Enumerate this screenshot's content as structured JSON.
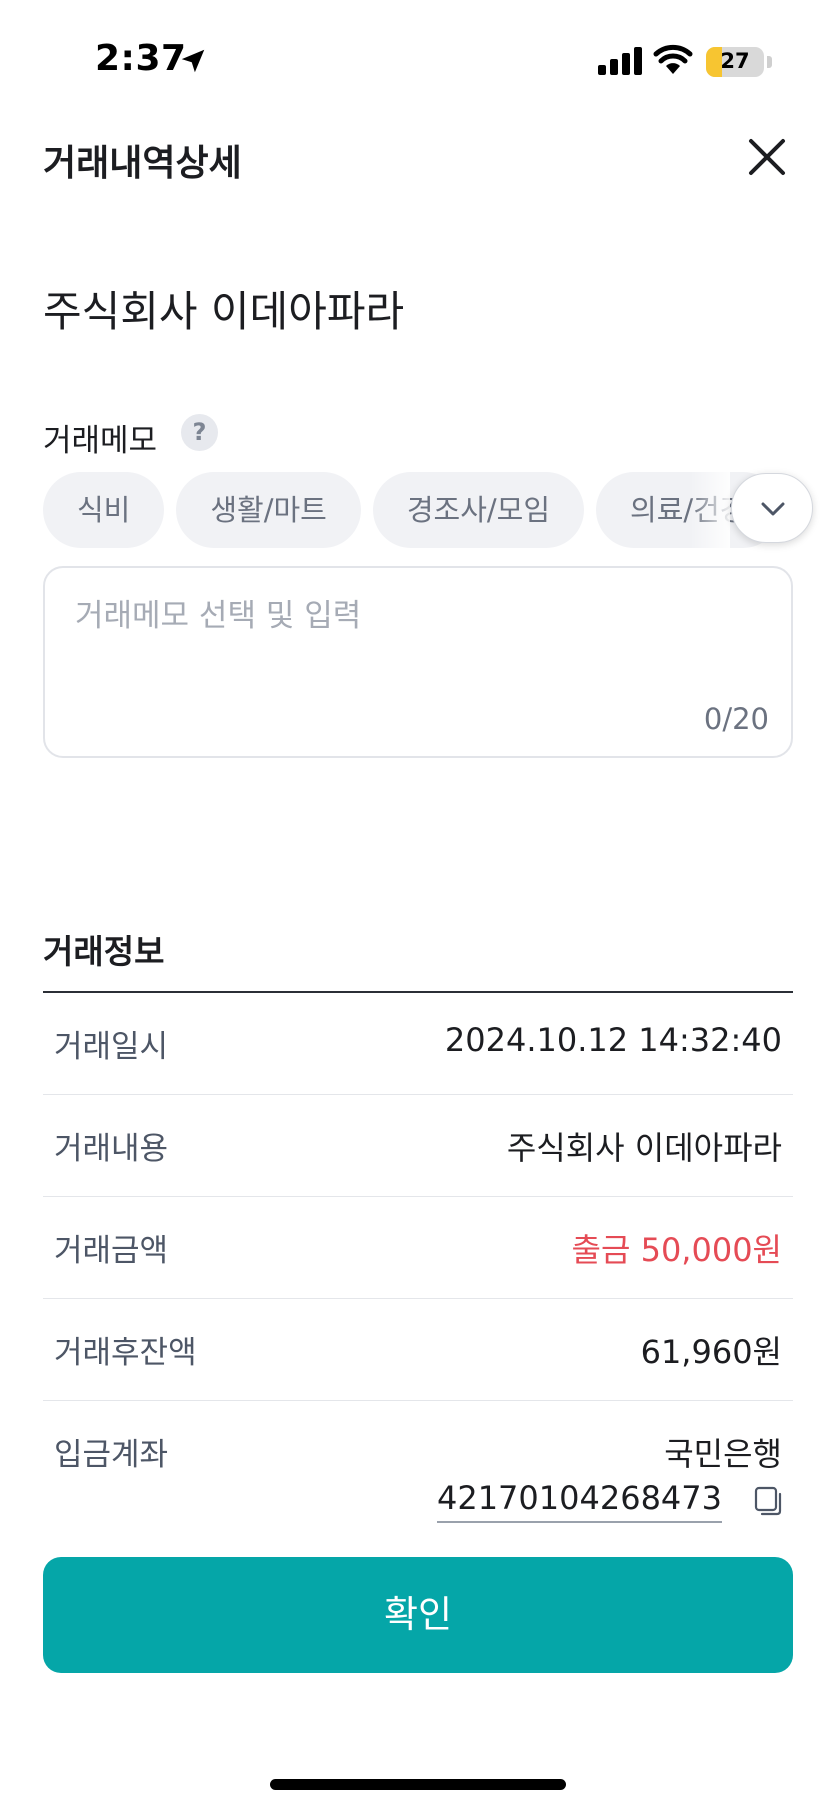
{
  "status_bar": {
    "time": "2:37",
    "battery_level": "27",
    "battery_fraction": 0.27,
    "battery_color": "#f7c531"
  },
  "header": {
    "title": "거래내역상세",
    "close_icon": "close-icon"
  },
  "merchant": {
    "name": "주식회사 이데아파라"
  },
  "memo": {
    "label": "거래메모",
    "help_icon": "question-icon",
    "chips": [
      "식비",
      "생활/마트",
      "경조사/모임",
      "의료/건강"
    ],
    "expand_icon": "chevron-down-icon",
    "placeholder": "거래메모 선택 및 입력",
    "value": "",
    "counter": "0/20"
  },
  "info": {
    "title": "거래정보",
    "rows": [
      {
        "label": "거래일시",
        "value": "2024.10.12 14:32:40"
      },
      {
        "label": "거래내용",
        "value": "주식회사 이데아파라"
      },
      {
        "label": "거래금액",
        "value": "출금 50,000원"
      },
      {
        "label": "거래후잔액",
        "value": "61,960원"
      }
    ],
    "account": {
      "label": "입금계좌",
      "bank": "국민은행",
      "number": "42170104268473",
      "copy_icon": "copy-icon"
    }
  },
  "confirm_button": {
    "label": "확인"
  },
  "colors": {
    "accent": "#05a6a8",
    "withdraw": "#e54b55",
    "text_primary": "#1c1d21",
    "text_secondary": "#4d5666"
  }
}
